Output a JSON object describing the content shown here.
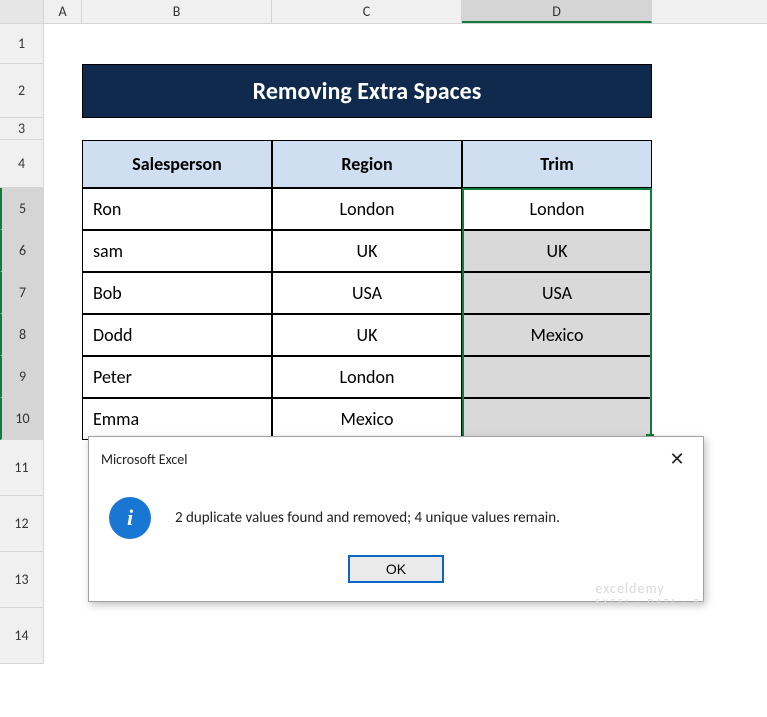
{
  "columns": {
    "a": "A",
    "b": "B",
    "c": "C",
    "d": "D"
  },
  "rows": {
    "r1": "1",
    "r2": "2",
    "r3": "3",
    "r4": "4",
    "r5": "5",
    "r6": "6",
    "r7": "7",
    "r8": "8",
    "r9": "9",
    "r10": "10",
    "r11": "11",
    "r12": "12",
    "r13": "13",
    "r14": "14"
  },
  "banner": {
    "title": "Removing Extra Spaces"
  },
  "table": {
    "headers": {
      "salesperson": "Salesperson",
      "region": "Region",
      "trim": "Trim"
    },
    "data": [
      {
        "salesperson": "Ron",
        "region": "London",
        "trim": "London",
        "shaded": false
      },
      {
        "salesperson": "sam",
        "region": "UK",
        "trim": "UK",
        "shaded": true
      },
      {
        "salesperson": "Bob",
        "region": "USA",
        "trim": "USA",
        "shaded": true
      },
      {
        "salesperson": "Dodd",
        "region": "UK",
        "trim": "Mexico",
        "shaded": true
      },
      {
        "salesperson": "Peter",
        "region": "London",
        "trim": "",
        "shaded": true
      },
      {
        "salesperson": "Emma",
        "region": "Mexico",
        "trim": "",
        "shaded": true
      }
    ]
  },
  "dialog": {
    "title": "Microsoft Excel",
    "message": "2 duplicate values found and removed; 4 unique values remain.",
    "ok": "OK",
    "icon": "i"
  },
  "watermark": {
    "main": "exceldemy",
    "sub": "EXCEL · DATA · BI"
  },
  "chart_data": {
    "type": "table",
    "title": "Removing Extra Spaces",
    "columns": [
      "Salesperson",
      "Region",
      "Trim"
    ],
    "rows": [
      [
        "Ron",
        "London",
        "London"
      ],
      [
        "sam",
        "UK",
        "UK"
      ],
      [
        "Bob",
        "USA",
        "USA"
      ],
      [
        "Dodd",
        "UK",
        "Mexico"
      ],
      [
        "Peter",
        "London",
        ""
      ],
      [
        "Emma",
        "Mexico",
        ""
      ]
    ]
  }
}
